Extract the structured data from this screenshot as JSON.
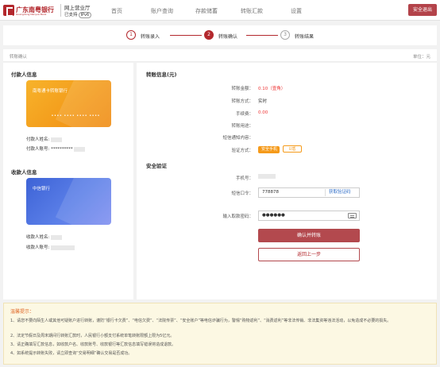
{
  "header": {
    "bank_name": "广东南粤银行",
    "bank_name_en": "Guangdong Nanyue Bank",
    "hall_label": "网上营业厅",
    "ipv6_prefix": "已支持",
    "ipv6_badge": "IPv6",
    "nav": [
      "首页",
      "账户查询",
      "存款储蓄",
      "转账汇款",
      "设置"
    ],
    "logout_label": "安全退出"
  },
  "steps": [
    {
      "num": "1",
      "label": "转账录入",
      "state": "done"
    },
    {
      "num": "2",
      "label": "转账确认",
      "state": "active"
    },
    {
      "num": "3",
      "label": "转账结果",
      "state": "todo"
    }
  ],
  "crumb": {
    "left": "转账确认",
    "right": "单位：元"
  },
  "payer": {
    "title": "付款人信息",
    "card_name": "南粤通卡转账银行",
    "card_number": "•••• •••• •••• ••••",
    "name_label": "付款人姓名:",
    "account_label": "付款人账号:",
    "account_value": "**********"
  },
  "payee": {
    "title": "收款人信息",
    "card_name": "中信银行",
    "name_label": "收款人姓名:",
    "account_label": "收款人账号:"
  },
  "transfer": {
    "title": "转账信息(元)",
    "amount_label": "转账金额：",
    "amount_value": "0.10（壹角）",
    "method_label": "转账方式：",
    "method_value": "实时",
    "fee_label": "手续费：",
    "fee_value": "0.00",
    "purpose_label": "转账用途：",
    "sms_label": "短信通知内容：",
    "verify_label": "验证方式：",
    "verify_options": [
      "安全手机",
      "U盾"
    ]
  },
  "security": {
    "title": "安全验证",
    "phone_label": "手机号：",
    "sms_code_label": "短信口令：",
    "sms_code_value": "778878",
    "get_code_label": "获取验证码",
    "pwd_label": "输入取款密码：",
    "pwd_value": "●●●●●●",
    "confirm_label": "确认并转账",
    "back_label": "返回上一步"
  },
  "notice": {
    "title": "温馨提示：",
    "lines": [
      "1、请您不要向陌生人或其他可疑账户进行转账，谨防“银行卡欠费”、“电信欠费”、“法院传票”、“安全账户”等电信诈骗行为，警惕“购物返利”、“消费返利”等非法传销、非法集资等违法活动，以免造成不必要的损失。",
      "2、法定节假日及周末期间行转账汇款时，人民银行小额支付系统单笔转账限额上限为5亿元。",
      "3、请正确填写汇款信息，如收款户名、收款账号、收款银行等汇款信息填写错误将造成退款。",
      "4、如系统提示转账失败，请立即查询“交易明细”确认交易是否成功。"
    ]
  }
}
